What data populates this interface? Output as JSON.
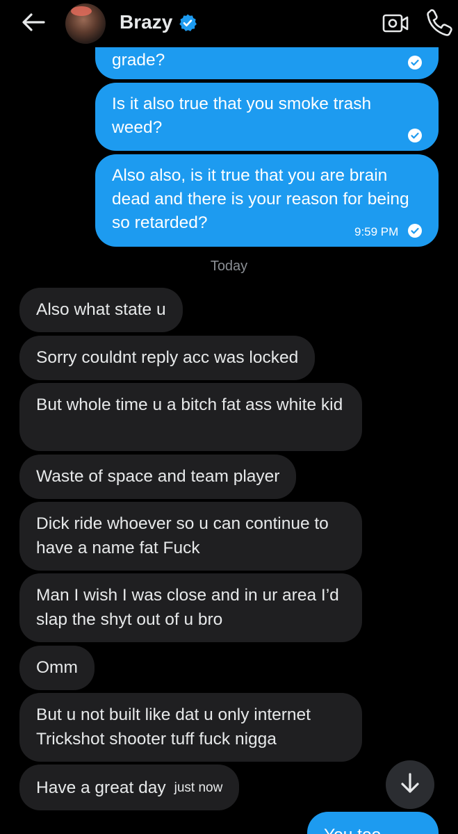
{
  "header": {
    "contact_name": "Brazy",
    "icons": [
      "back-arrow-icon",
      "verified-badge-icon",
      "video-call-icon",
      "phone-call-icon"
    ]
  },
  "colors": {
    "outgoing": "#1d9bf0",
    "incoming": "#1f1f21",
    "background": "#000000"
  },
  "messages_out_before": [
    {
      "text": "grade?",
      "partial": true
    },
    {
      "text": "Is it also true that you smoke trash weed?"
    },
    {
      "text": "Also also, is it true that you are brain dead and there is your reason for being so retarded?",
      "time": "9:59 PM"
    }
  ],
  "day_divider": "Today",
  "messages_in": [
    {
      "text": "Also what state u"
    },
    {
      "text": "Sorry couldnt reply acc was locked"
    },
    {
      "text": "But whole time u a bitch fat ass white kid"
    },
    {
      "text": "Waste of space and team player"
    },
    {
      "text": "Dick ride whoever so u can continue to have a name fat Fuck"
    },
    {
      "text": "Man I wish I was close and in ur area I’d slap the shyt out of u bro"
    },
    {
      "text": "Omm"
    },
    {
      "text": "But u not built like dat u only internet Trickshot shooter tuff fuck nigga"
    },
    {
      "text": "Have a great day",
      "time": "just now"
    }
  ],
  "messages_out_after": [
    {
      "text": "You too",
      "partial": true
    }
  ]
}
